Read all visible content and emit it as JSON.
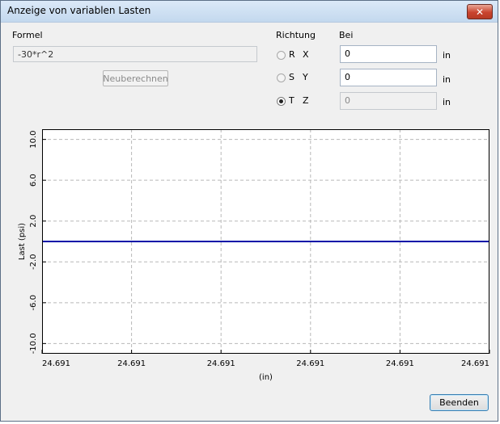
{
  "window": {
    "title": "Anzeige von variablen Lasten",
    "close_icon": "close-icon"
  },
  "formula": {
    "label": "Formel",
    "value": "-30*r^2",
    "recalc_label": "Neuberechnen"
  },
  "direction": {
    "header": "Richtung",
    "options": [
      {
        "letter": "R",
        "axis": "X",
        "selected": false
      },
      {
        "letter": "S",
        "axis": "Y",
        "selected": false
      },
      {
        "letter": "T",
        "axis": "Z",
        "selected": true
      }
    ]
  },
  "at": {
    "header": "Bei",
    "fields": [
      {
        "value": "0",
        "unit": "in",
        "enabled": true
      },
      {
        "value": "0",
        "unit": "in",
        "enabled": true
      },
      {
        "value": "0",
        "unit": "in",
        "enabled": false
      }
    ]
  },
  "chart_data": {
    "type": "line",
    "title": "",
    "xlabel": "(in)",
    "ylabel": "Last (psi)",
    "ylim": [
      -11.0,
      11.0
    ],
    "yticks": [
      "10.0",
      "6.0",
      "2.0",
      "-2.0",
      "-6.0",
      "-10.0"
    ],
    "ytick_values": [
      10,
      6,
      2,
      -2,
      -6,
      -10
    ],
    "xticks": [
      "24.691",
      "24.691",
      "24.691",
      "24.691",
      "24.691",
      "24.691"
    ],
    "grid": true,
    "series": [
      {
        "color": "#0010a8",
        "y": [
          0,
          0
        ]
      }
    ]
  },
  "buttons": {
    "end_label": "Beenden"
  }
}
